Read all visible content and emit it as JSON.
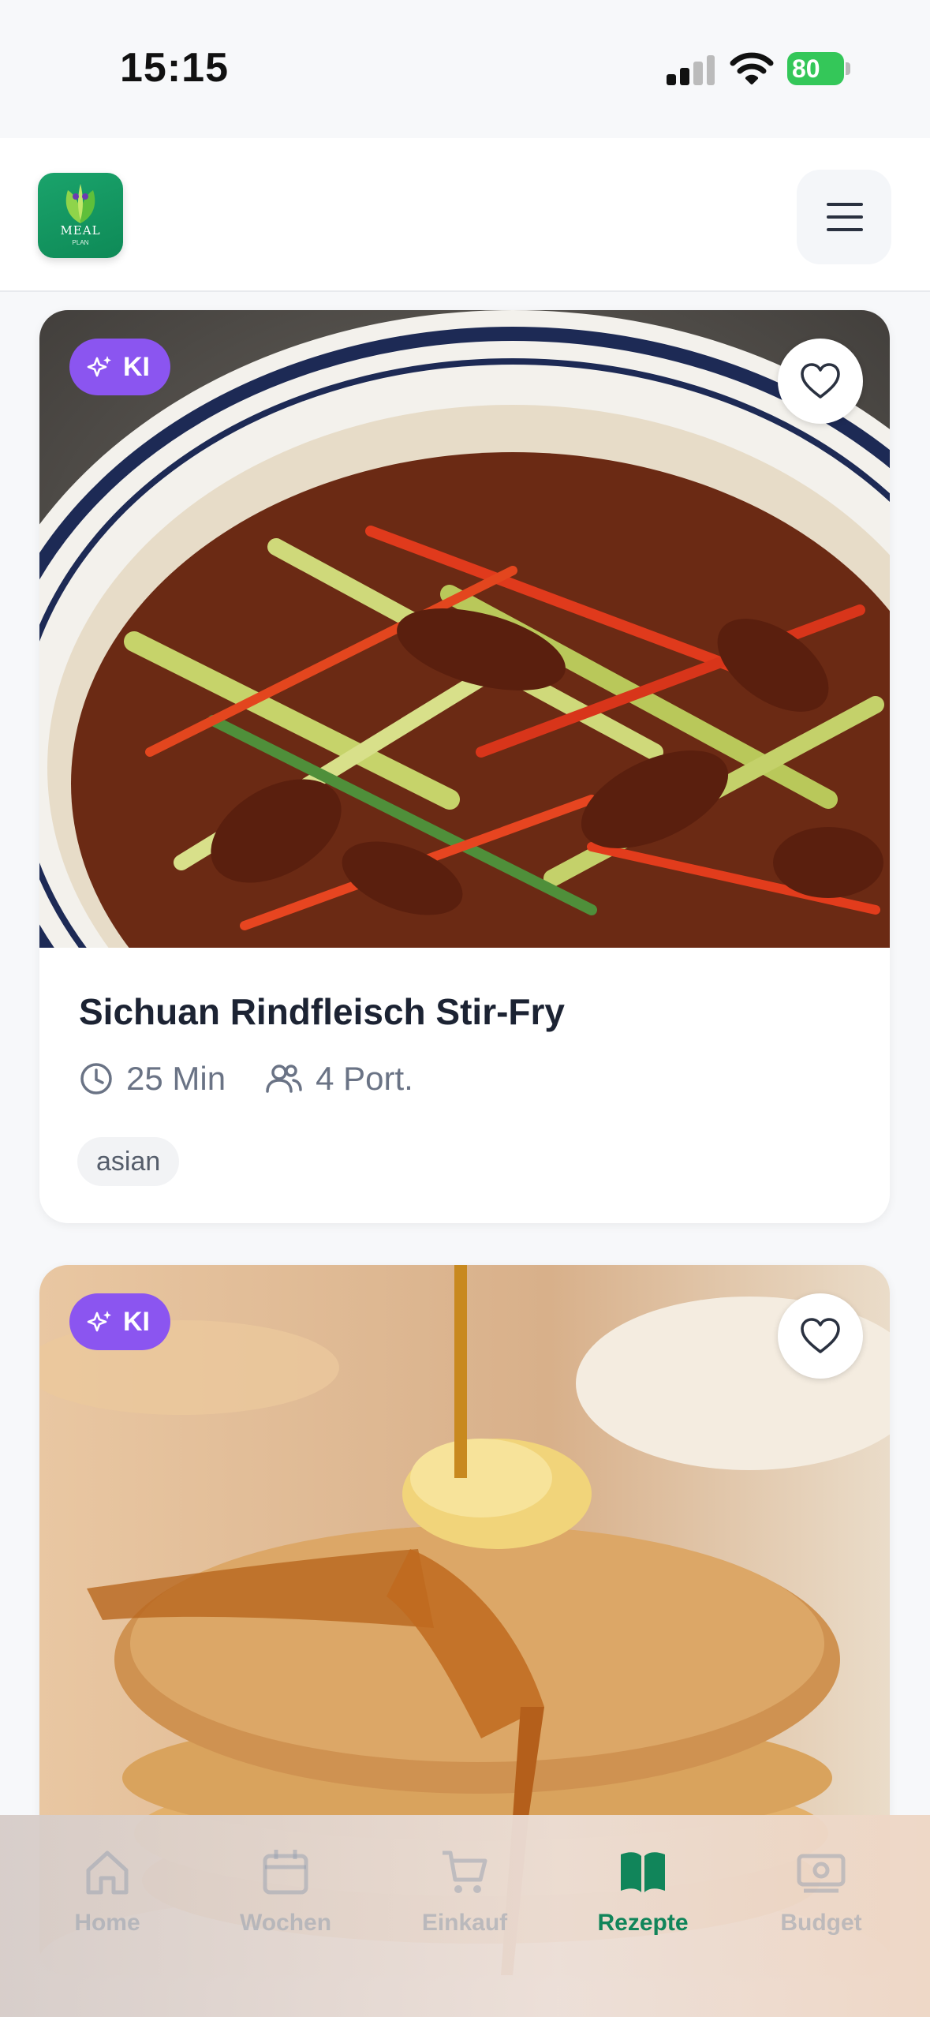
{
  "status_bar": {
    "time": "15:15",
    "battery": "80"
  },
  "header": {
    "logo_text": "MEAL",
    "logo_sub": "PLAN"
  },
  "cards": [
    {
      "badge": "KI",
      "title": "Sichuan Rindfleisch Stir-Fry",
      "time": "25 Min",
      "portions": "4 Port.",
      "tag": "asian"
    },
    {
      "badge": "KI"
    }
  ],
  "bottom_nav": {
    "items": [
      {
        "label": "Home",
        "icon": "home-icon",
        "active": false
      },
      {
        "label": "Wochen",
        "icon": "calendar-icon",
        "active": false
      },
      {
        "label": "Einkauf",
        "icon": "cart-icon",
        "active": false
      },
      {
        "label": "Rezepte",
        "icon": "book-icon",
        "active": true
      },
      {
        "label": "Budget",
        "icon": "money-icon",
        "active": false
      }
    ]
  },
  "colors": {
    "accent": "#11855a",
    "badge": "#8b55f0"
  }
}
